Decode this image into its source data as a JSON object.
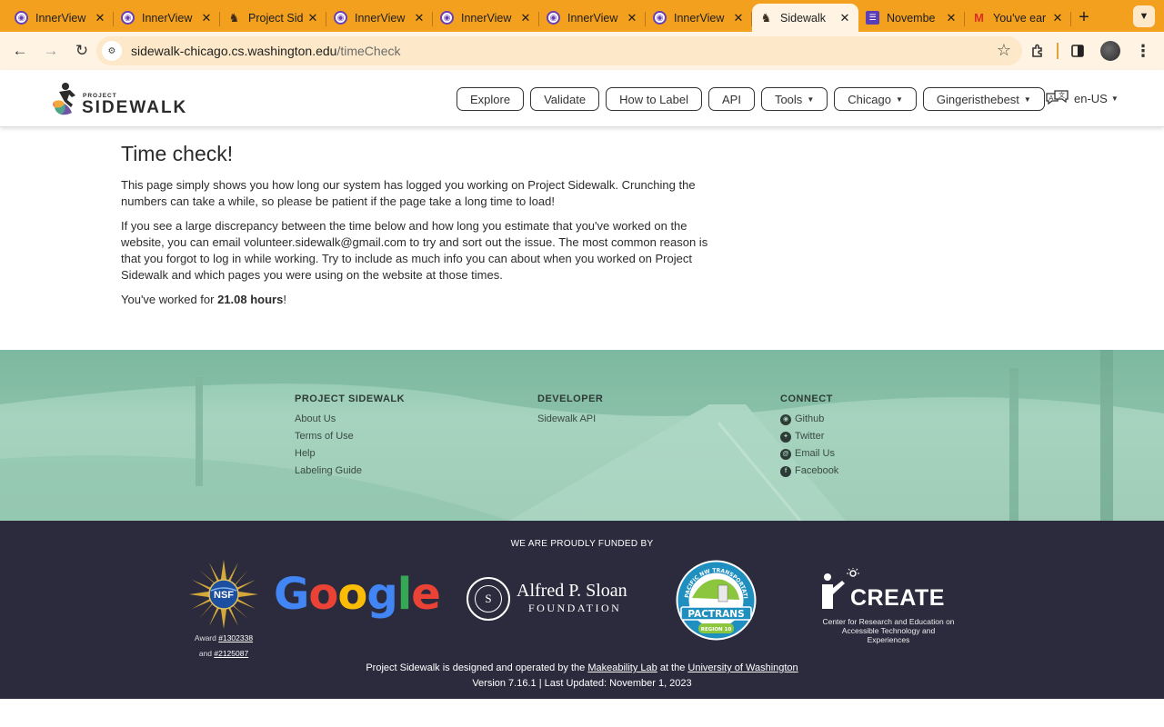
{
  "browser": {
    "tabs": [
      {
        "title": "InnerView",
        "favicon": "innerview-icon",
        "active": false
      },
      {
        "title": "InnerView",
        "favicon": "innerview-icon",
        "active": false
      },
      {
        "title": "Project Sid",
        "favicon": "project-sidewalk-icon",
        "active": false
      },
      {
        "title": "InnerView",
        "favicon": "innerview-icon",
        "active": false
      },
      {
        "title": "InnerView",
        "favicon": "innerview-icon",
        "active": false
      },
      {
        "title": "InnerView",
        "favicon": "innerview-icon",
        "active": false
      },
      {
        "title": "InnerView",
        "favicon": "innerview-icon",
        "active": false
      },
      {
        "title": "Sidewalk",
        "favicon": "project-sidewalk-icon",
        "active": true
      },
      {
        "title": "Novembe",
        "favicon": "calendar-form-icon",
        "active": false
      },
      {
        "title": "You've ear",
        "favicon": "gmail-icon",
        "active": false
      }
    ],
    "url_host": "sidewalk-chicago.cs.washington.edu",
    "url_path": "/timeCheck",
    "theme_color": "#f3a01f"
  },
  "header": {
    "logo_small": "PROJECT",
    "logo_big": "SIDEWALK",
    "nav": [
      {
        "label": "Explore",
        "dropdown": false
      },
      {
        "label": "Validate",
        "dropdown": false
      },
      {
        "label": "How to Label",
        "dropdown": false
      },
      {
        "label": "API",
        "dropdown": false
      },
      {
        "label": "Tools",
        "dropdown": true
      },
      {
        "label": "Chicago",
        "dropdown": true
      },
      {
        "label": "Gingeristhebest",
        "dropdown": true
      }
    ],
    "language": "en-US"
  },
  "main": {
    "title": "Time check!",
    "para1": "This page simply shows you how long our system has logged you working on Project Sidewalk. Crunching the numbers can take a while, so please be patient if the page take a long time to load!",
    "para2": "If you see a large discrepancy between the time below and how long you estimate that you've worked on the website, you can email volunteer.sidewalk@gmail.com to try and sort out the issue. The most common reason is that you forgot to log in while working. Try to include as much info you can about when you worked on Project Sidewalk and which pages you were using on the website at those times.",
    "worked_prefix": "You've worked for ",
    "worked_hours": "21.08 hours",
    "worked_suffix": "!"
  },
  "footer": {
    "columns": [
      {
        "heading": "PROJECT SIDEWALK",
        "links": [
          "About Us",
          "Terms of Use",
          "Help",
          "Labeling Guide"
        ]
      },
      {
        "heading": "DEVELOPER",
        "links": [
          "Sidewalk API"
        ]
      },
      {
        "heading": "CONNECT",
        "links": [
          "Github",
          "Twitter",
          "Email Us",
          "Facebook"
        ]
      }
    ],
    "funded_by": "WE ARE PROUDLY FUNDED BY",
    "nsf": {
      "label": "NSF",
      "award_prefix": "Award ",
      "award1": "#1302338",
      "award_and": "and ",
      "award2": "#2125087"
    },
    "google": "Google",
    "sloan": {
      "line1": "Alfred P. Sloan",
      "line2": "FOUNDATION"
    },
    "pactrans": {
      "label": "PACTRANS",
      "ring_text": "PACIFIC NW TRANSPORTATION CONSORTIUM",
      "region": "REGION 10"
    },
    "create": {
      "word": "CREATE",
      "line1": "Center for Research and Education on",
      "line2": "Accessible Technology and Experiences"
    },
    "credit_prefix": "Project Sidewalk is designed and operated by the ",
    "credit_lab": "Makeability Lab",
    "credit_mid": " at the ",
    "credit_uni": "University of Washington",
    "version": "Version 7.16.1 | Last Updated: November 1, 2023"
  }
}
